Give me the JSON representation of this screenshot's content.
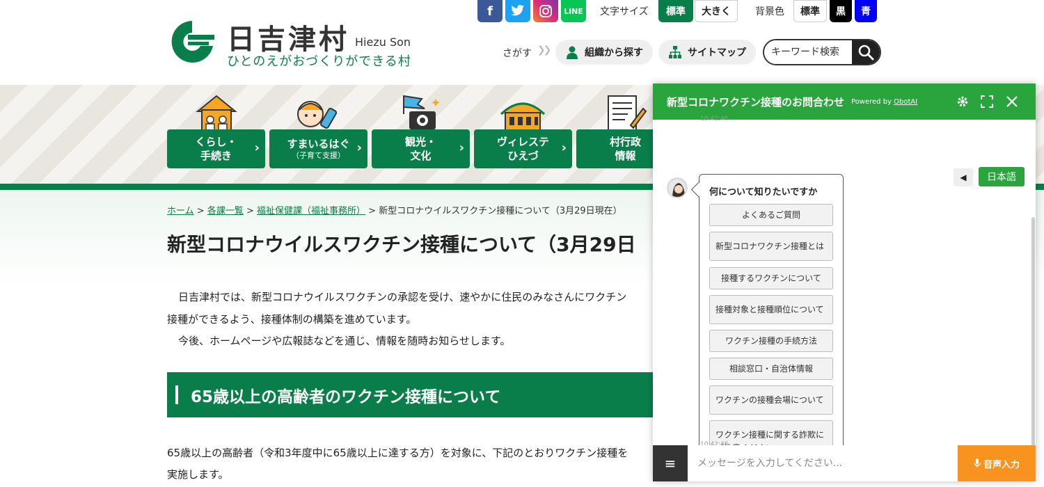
{
  "header": {
    "logo_title": "日吉津村",
    "logo_roman": "Hiezu Son",
    "logo_tagline": "ひとのえがおづくりができる村",
    "font_size_label": "文字サイズ",
    "font_size_standard": "標準",
    "font_size_large": "大きく",
    "bg_color_label": "背景色",
    "bg_standard": "標準",
    "bg_black": "黒",
    "bg_blue": "青",
    "search_label": "さがす",
    "org_search": "組織から探す",
    "site_map": "サイトマップ",
    "search_placeholder": "キーワード検索",
    "social": {
      "line": "LINE"
    }
  },
  "nav": {
    "items": [
      {
        "line1": "くらし・",
        "line2": "手続き"
      },
      {
        "line1": "すまいるはぐ",
        "line2": "（子育て支援）"
      },
      {
        "line1": "観光・",
        "line2": "文化"
      },
      {
        "line1": "ヴィレステ",
        "line2": "ひえづ"
      },
      {
        "line1": "村行政",
        "line2": "情報"
      }
    ]
  },
  "breadcrumb": {
    "home": "ホーム",
    "sep": ">",
    "dept_list": "各課一覧",
    "welfare": "福祉保健課（福祉事務所）",
    "current": "新型コロナウイルスワクチン接種について（3月29日現在）"
  },
  "main": {
    "title": "新型コロナウイルスワクチン接種について（3月29日",
    "para1_line1": "日吉津村では、新型コロナウイルスワクチンの承認を受け、速やかに住民のみなさんにワクチン",
    "para1_line2": "接種ができるよう、接種体制の構築を進めています。",
    "para2": "今後、ホームページや広報誌などを通じ、情報を随時お知らせします。",
    "section_heading": "65歳以上の高齢者のワクチン接種について",
    "para3_line1": "65歳以上の高齢者（令和3年度中に65歳以上に達する方）を対象に、下記のとおりワクチン接種を",
    "para3_line2": "実施します。"
  },
  "chat": {
    "title": "新型コロナワクチン接種のお問合わせ",
    "powered_by": "Powered by",
    "powered_brand": "ObotAI",
    "timestamp_top": "10:42:46",
    "timestamp_bottom": "10:42:46",
    "question": "何について知りたいですか",
    "options": [
      "よくあるご質問",
      "新型コロナワクチン接種とは",
      "接種するワクチンについて",
      "接種対象と接種順位について",
      "ワクチン接種の手続方法",
      "相談窓口・自治体情報",
      "ワクチンの接種会場について",
      "ワクチン接種に関する詐欺に\nご注意ください"
    ],
    "language": "日本語",
    "input_placeholder": "メッセージを入力してください...",
    "voice_input": "音声入力"
  },
  "colors": {
    "brand_green": "#0a7e4a",
    "chat_green": "#2aa43c",
    "voice_orange": "#f7931e"
  }
}
